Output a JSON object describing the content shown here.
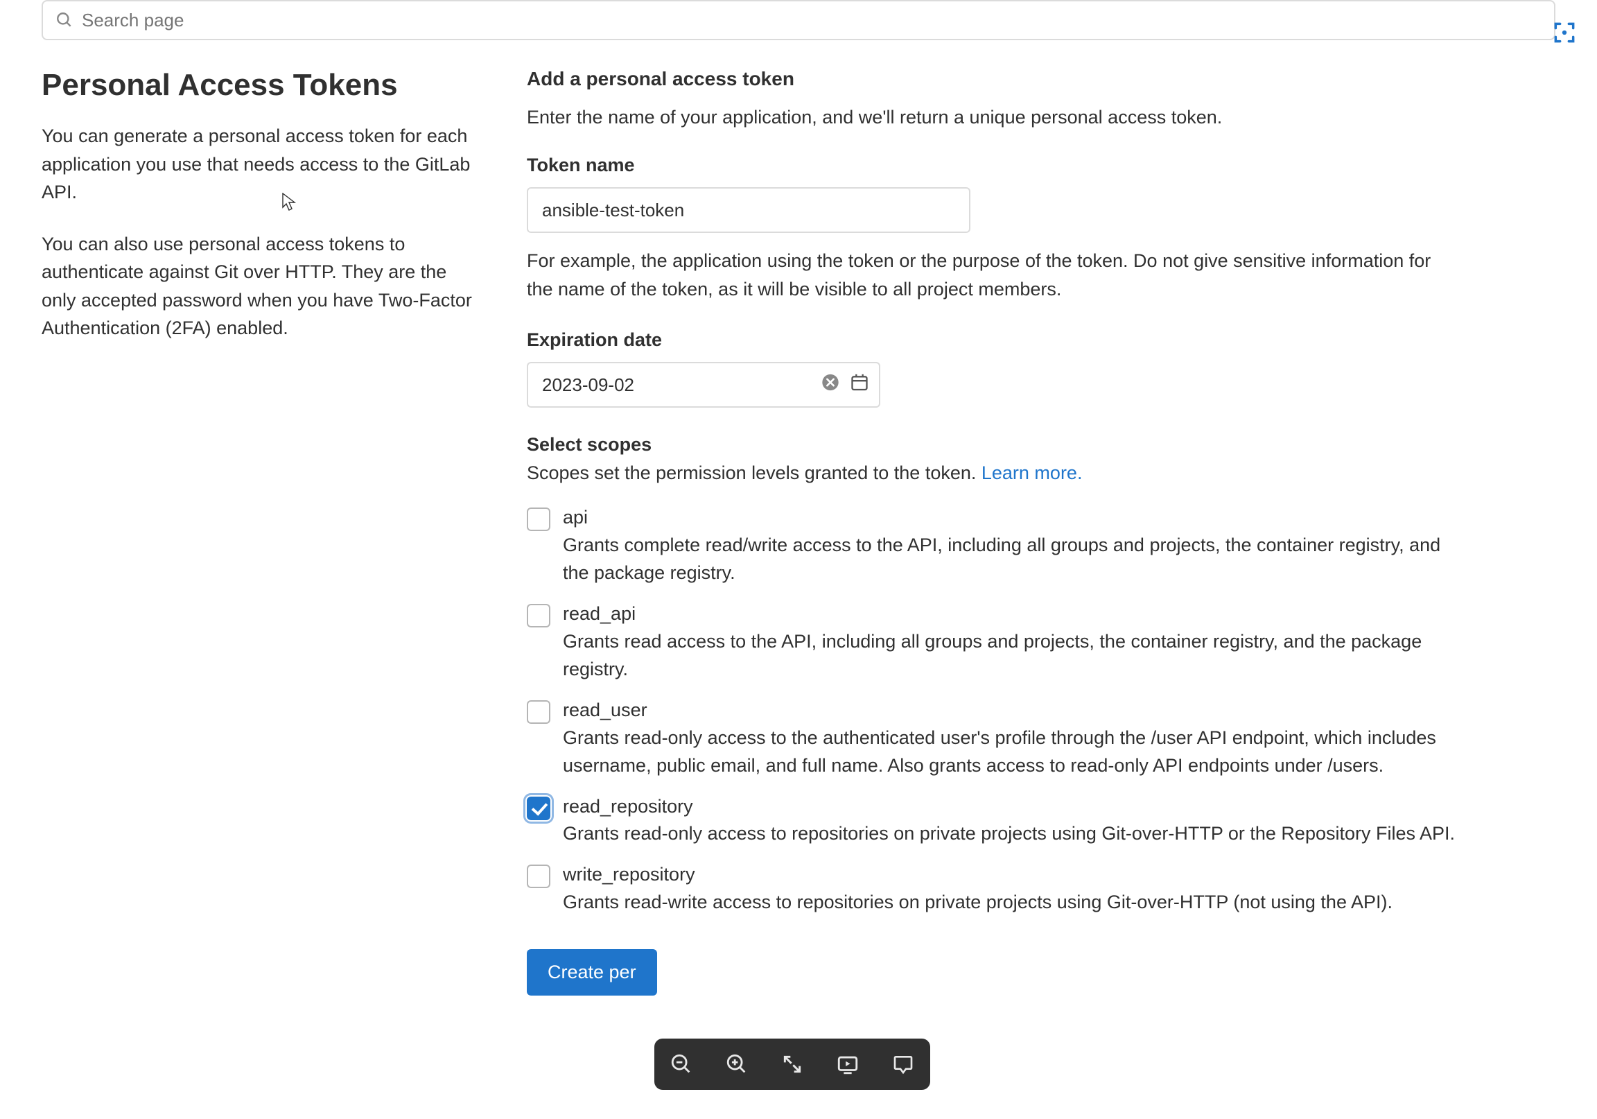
{
  "search": {
    "placeholder": "Search page"
  },
  "sidebar": {
    "title": "Personal Access Tokens",
    "p1": "You can generate a personal access token for each application you use that needs access to the GitLab API.",
    "p2": "You can also use personal access tokens to authenticate against Git over HTTP. They are the only accepted password when you have Two-Factor Authentication (2FA) enabled."
  },
  "form": {
    "heading": "Add a personal access token",
    "sub": "Enter the name of your application, and we'll return a unique personal access token.",
    "token_name_label": "Token name",
    "token_name_value": "ansible-test-token",
    "token_name_help": "For example, the application using the token or the purpose of the token. Do not give sensitive information for the name of the token, as it will be visible to all project members.",
    "expiration_label": "Expiration date",
    "expiration_value": "2023-09-02",
    "scopes_label": "Select scopes",
    "scopes_desc": "Scopes set the permission levels granted to the token. ",
    "scopes_learn": "Learn more.",
    "create_label": "Create per"
  },
  "scopes": [
    {
      "name": "api",
      "checked": false,
      "desc": "Grants complete read/write access to the API, including all groups and projects, the container registry, and the package registry."
    },
    {
      "name": "read_api",
      "checked": false,
      "desc": "Grants read access to the API, including all groups and projects, the container registry, and the package registry."
    },
    {
      "name": "read_user",
      "checked": false,
      "desc": "Grants read-only access to the authenticated user's profile through the /user API endpoint, which includes username, public email, and full name. Also grants access to read-only API endpoints under /users."
    },
    {
      "name": "read_repository",
      "checked": true,
      "desc": "Grants read-only access to repositories on private projects using Git-over-HTTP or the Repository Files API."
    },
    {
      "name": "write_repository",
      "checked": false,
      "desc": "Grants read-write access to repositories on private projects using Git-over-HTTP (not using the API)."
    }
  ]
}
